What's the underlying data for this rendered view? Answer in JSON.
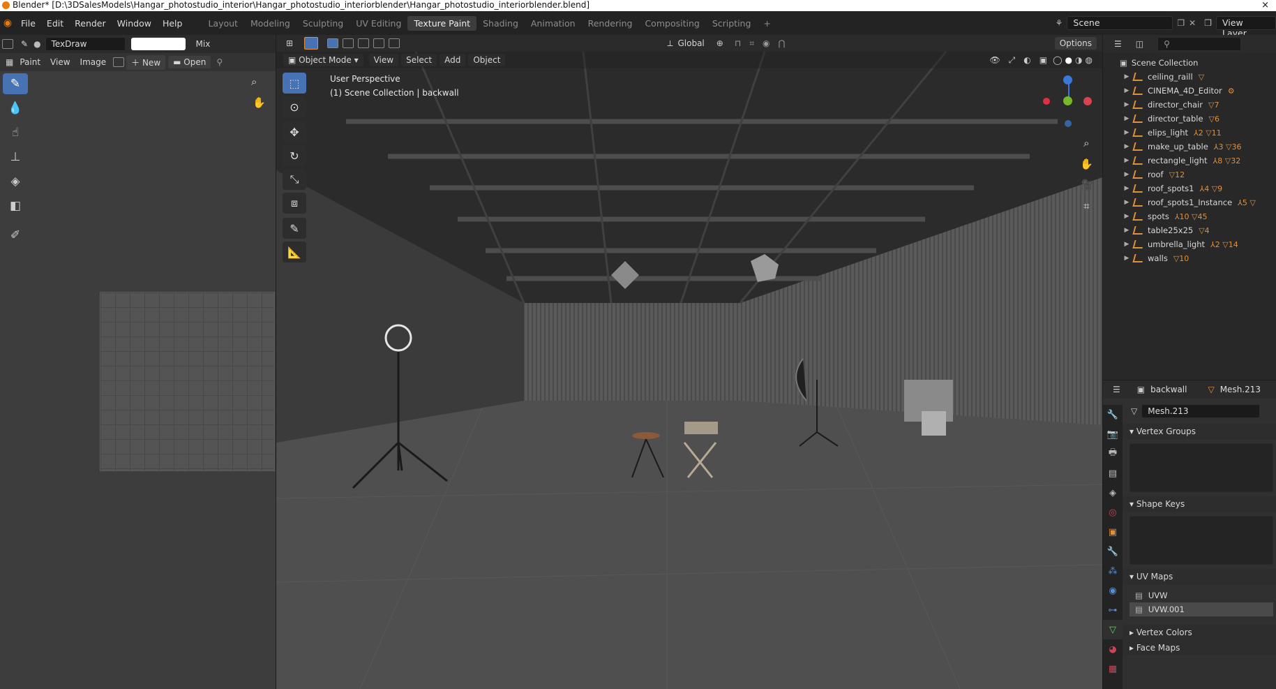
{
  "window": {
    "title": "Blender* [D:\\3DSalesModels\\Hangar_photostudio_interior\\Hangar_photostudio_interiorblender\\Hangar_photostudio_interiorblender.blend]",
    "close": "×"
  },
  "menubar": {
    "items": [
      "File",
      "Edit",
      "Render",
      "Window",
      "Help"
    ]
  },
  "workspaces": {
    "tabs": [
      "Layout",
      "Modeling",
      "Sculpting",
      "UV Editing",
      "Texture Paint",
      "Shading",
      "Animation",
      "Rendering",
      "Compositing",
      "Scripting"
    ],
    "active": "Texture Paint",
    "add": "+"
  },
  "scene": {
    "name": "Scene",
    "view_layer": "View Layer"
  },
  "image_editor": {
    "brush": "TexDraw",
    "blend": "Mix",
    "menus": [
      "Paint",
      "View",
      "Image"
    ],
    "new_label": "New",
    "open_label": "Open"
  },
  "viewport": {
    "mode": "Object Mode",
    "menus": [
      "View",
      "Select",
      "Add",
      "Object"
    ],
    "orientation": "Global",
    "options": "Options",
    "perspective": "User Perspective",
    "collection_info": "(1) Scene Collection | backwall"
  },
  "outliner": {
    "root": "Scene Collection",
    "items": [
      {
        "name": "ceiling_raill",
        "icons": "▽"
      },
      {
        "name": "CINEMA_4D_Editor",
        "icons": "⚙"
      },
      {
        "name": "director_chair",
        "icons": "▽7"
      },
      {
        "name": "director_table",
        "icons": "▽6"
      },
      {
        "name": "elips_light",
        "icons": "⅄2 ▽11"
      },
      {
        "name": "make_up_table",
        "icons": "⅄3 ▽36"
      },
      {
        "name": "rectangle_light",
        "icons": "⅄8 ▽32"
      },
      {
        "name": "roof",
        "icons": "▽12"
      },
      {
        "name": "roof_spots1",
        "icons": "⅄4 ▽9"
      },
      {
        "name": "roof_spots1_Instance",
        "icons": "⅄5 ▽"
      },
      {
        "name": "spots",
        "icons": "⅄10 ▽45"
      },
      {
        "name": "table25x25",
        "icons": "▽4"
      },
      {
        "name": "umbrella_light",
        "icons": "⅄2 ▽14"
      },
      {
        "name": "walls",
        "icons": "▽10"
      }
    ]
  },
  "properties": {
    "object": "backwall",
    "mesh": "Mesh.213",
    "mesh_field": "Mesh.213",
    "sections": {
      "vertex_groups": "Vertex Groups",
      "shape_keys": "Shape Keys",
      "uv_maps": "UV Maps",
      "vertex_colors": "Vertex Colors",
      "face_maps": "Face Maps"
    },
    "uv_maps": [
      "UVW",
      "UVW.001"
    ]
  },
  "colors": {
    "accent": "#4772b3",
    "orange": "#e0913a",
    "bg": "#303030"
  }
}
